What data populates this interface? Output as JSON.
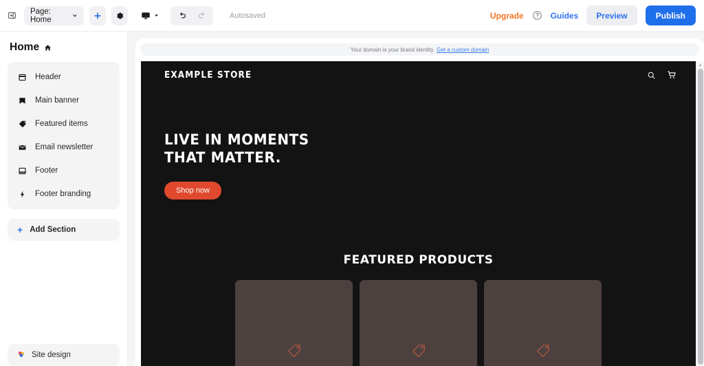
{
  "toolbar": {
    "collapse_icon": "collapse-sidebar-icon",
    "page_select_label": "Page: Home",
    "add_page_label": "+",
    "settings_icon": "gear-icon",
    "device_icon": "desktop-icon",
    "undo_icon": "undo-arrow-icon",
    "redo_icon": "redo-arrow-icon",
    "autosaved_label": "Autosaved",
    "upgrade_label": "Upgrade",
    "help_icon": "help-circle-icon",
    "guides_label": "Guides",
    "preview_label": "Preview",
    "publish_label": "Publish",
    "accent_blue": "#1f6feb",
    "accent_orange": "#f07524"
  },
  "sidebar": {
    "title": "Home",
    "title_icon": "home-icon",
    "items": [
      {
        "label": "Header",
        "icon": "header-layout-icon"
      },
      {
        "label": "Main banner",
        "icon": "banner-icon"
      },
      {
        "label": "Featured items",
        "icon": "tag-icon"
      },
      {
        "label": "Email newsletter",
        "icon": "envelope-icon"
      },
      {
        "label": "Footer",
        "icon": "footer-layout-icon"
      },
      {
        "label": "Footer branding",
        "icon": "lightning-bolt-icon"
      }
    ],
    "add_section_label": "Add Section",
    "site_design_label": "Site design",
    "site_design_icon": "palette-icon"
  },
  "canvas": {
    "domain_banner": {
      "text": "Your domain is your brand identity.",
      "link_label": "Get a custom domain"
    },
    "site": {
      "brand": "EXAMPLE STORE",
      "header_icons": [
        "search-icon",
        "shopping-cart-icon"
      ],
      "hero": {
        "headline_line1": "LIVE IN MOMENTS",
        "headline_line2": "THAT MATTER.",
        "cta_label": "Shop now",
        "cta_color": "#e0492d"
      },
      "featured": {
        "title": "FEATURED PRODUCTS",
        "cards": [
          {
            "icon": "tag-icon"
          },
          {
            "icon": "tag-icon"
          },
          {
            "icon": "tag-icon"
          }
        ],
        "card_color": "#4d4140",
        "icon_color": "#c05a3d"
      },
      "background": "#131313"
    },
    "scrollbar": {
      "up_arrow": "▴"
    }
  }
}
